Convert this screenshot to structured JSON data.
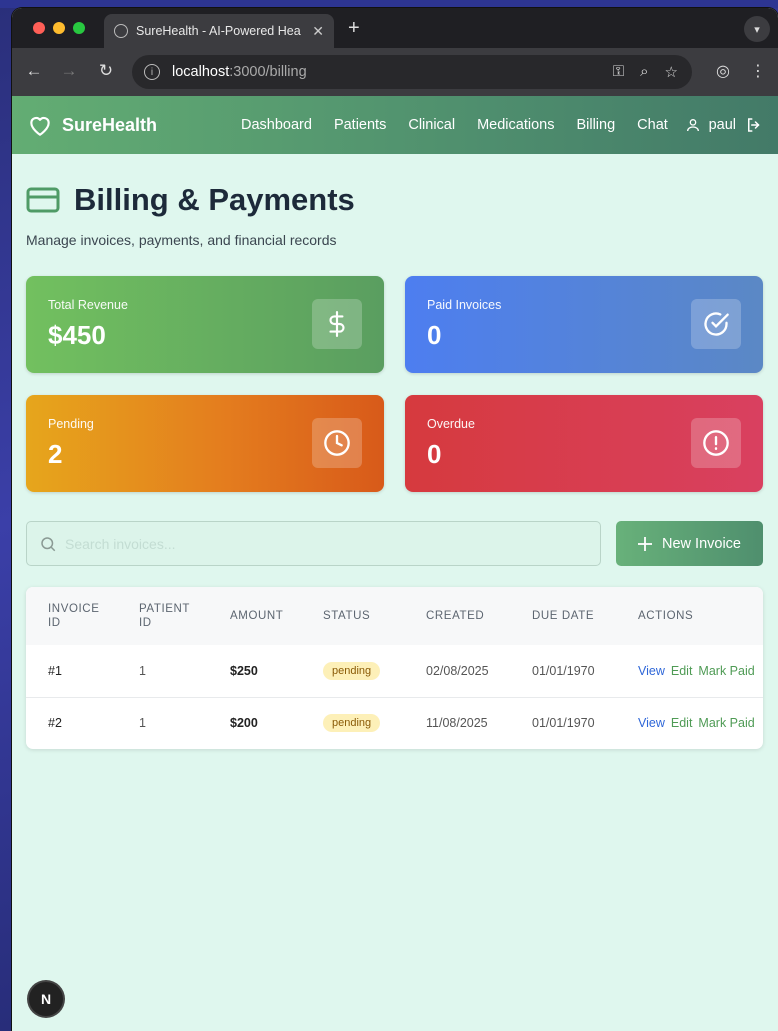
{
  "browser": {
    "tab_title": "SureHealth - AI-Powered Hea",
    "url_host": "localhost",
    "url_path": ":3000/billing"
  },
  "nav": {
    "brand": "SureHealth",
    "links": [
      "Dashboard",
      "Patients",
      "Clinical",
      "Medications",
      "Billing",
      "Chat"
    ],
    "user": "paul"
  },
  "page": {
    "title": "Billing & Payments",
    "subtitle": "Manage invoices, payments, and financial records"
  },
  "stats": [
    {
      "label": "Total Revenue",
      "value": "$450",
      "icon": "dollar-icon",
      "color": "#6bb45f"
    },
    {
      "label": "Paid Invoices",
      "value": "0",
      "icon": "check-circle-icon",
      "color": "#4d7ef0"
    },
    {
      "label": "Pending",
      "value": "2",
      "icon": "clock-icon",
      "color": "#e4881d"
    },
    {
      "label": "Overdue",
      "value": "0",
      "icon": "alert-circle-icon",
      "color": "#d63a4e"
    }
  ],
  "search": {
    "placeholder": "Search invoices..."
  },
  "new_invoice_label": "New Invoice",
  "table": {
    "headers": [
      "Invoice ID",
      "Patient ID",
      "Amount",
      "Status",
      "Created",
      "Due Date",
      "Actions"
    ],
    "rows": [
      {
        "id": "#1",
        "patient": "1",
        "amount": "$250",
        "status": "pending",
        "created": "02/08/2025",
        "due": "01/01/1970"
      },
      {
        "id": "#2",
        "patient": "1",
        "amount": "$200",
        "status": "pending",
        "created": "11/08/2025",
        "due": "01/01/1970"
      }
    ],
    "action_labels": {
      "view": "View",
      "edit": "Edit",
      "mark_paid": "Mark Paid"
    }
  },
  "dev_badge": "N"
}
